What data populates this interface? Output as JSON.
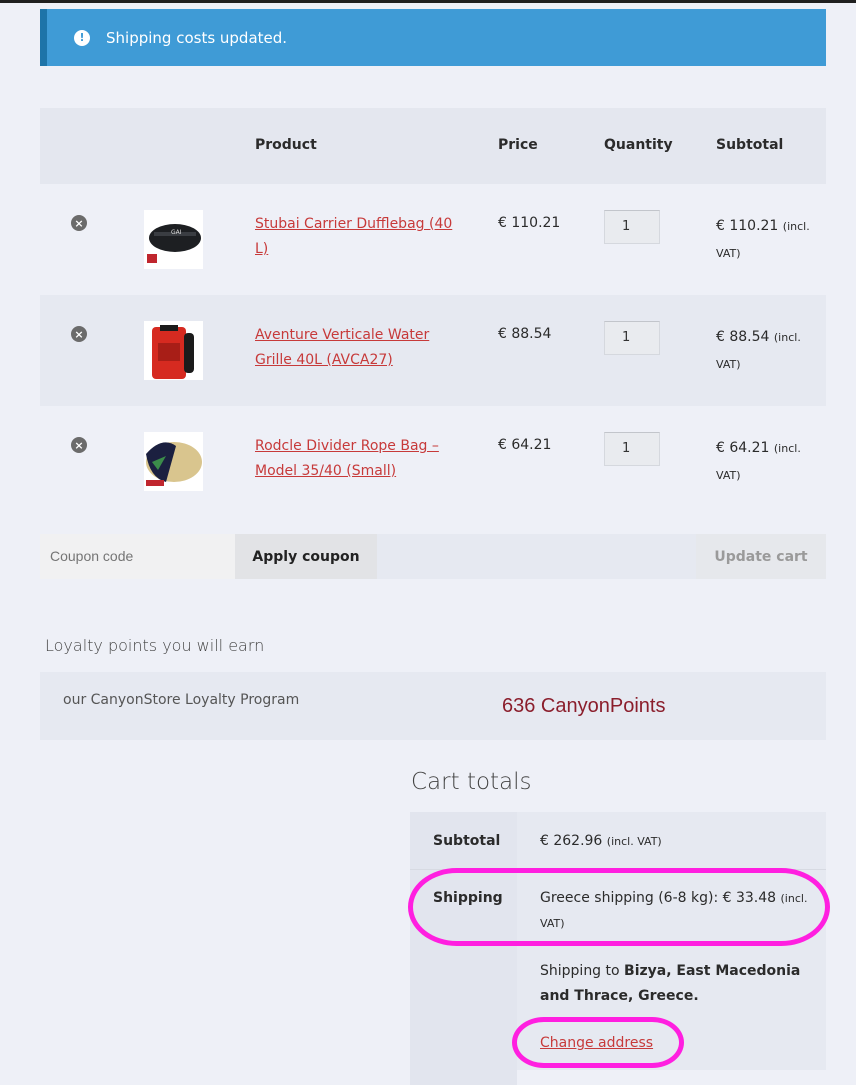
{
  "notice": {
    "icon": "exclamation-icon",
    "message": "Shipping costs updated."
  },
  "cart": {
    "headers": {
      "product": "Product",
      "price": "Price",
      "quantity": "Quantity",
      "subtotal": "Subtotal"
    },
    "items": [
      {
        "name": "Stubai Carrier Dufflebag (40 L)",
        "price": "€ 110.21",
        "quantity": "1",
        "subtotal": "€ 110.21",
        "vat": "(incl. VAT)"
      },
      {
        "name": "Aventure Verticale Water Grille 40L (AVCA27)",
        "price": "€ 88.54",
        "quantity": "1",
        "subtotal": "€ 88.54",
        "vat": "(incl. VAT)"
      },
      {
        "name": "Rodcle Divider Rope Bag – Model 35/40 (Small)",
        "price": "€ 64.21",
        "quantity": "1",
        "subtotal": "€ 64.21",
        "vat": "(incl. VAT)"
      }
    ],
    "coupon_placeholder": "Coupon code",
    "apply_coupon": "Apply coupon",
    "update_cart": "Update cart"
  },
  "loyalty": {
    "title": "Loyalty points you will earn",
    "program": "our CanyonStore Loyalty Program",
    "points": "636 CanyonPoints"
  },
  "totals": {
    "title": "Cart totals",
    "subtotal_label": "Subtotal",
    "subtotal_value": "€ 262.96",
    "subtotal_vat": "(incl. VAT)",
    "shipping_label": "Shipping",
    "shipping_method": "Greece shipping (6-8 kg): € 33.48",
    "shipping_vat": "(incl. VAT)",
    "shipping_to_prefix": "Shipping to",
    "shipping_destination": "Bizya, East Macedonia and Thrace, Greece.",
    "change_address": "Change address"
  },
  "colors": {
    "accent_link": "#c73a3a",
    "notice_bg": "#3f9bd6",
    "highlight": "#ff1fe0",
    "points": "#8b1e2c"
  }
}
